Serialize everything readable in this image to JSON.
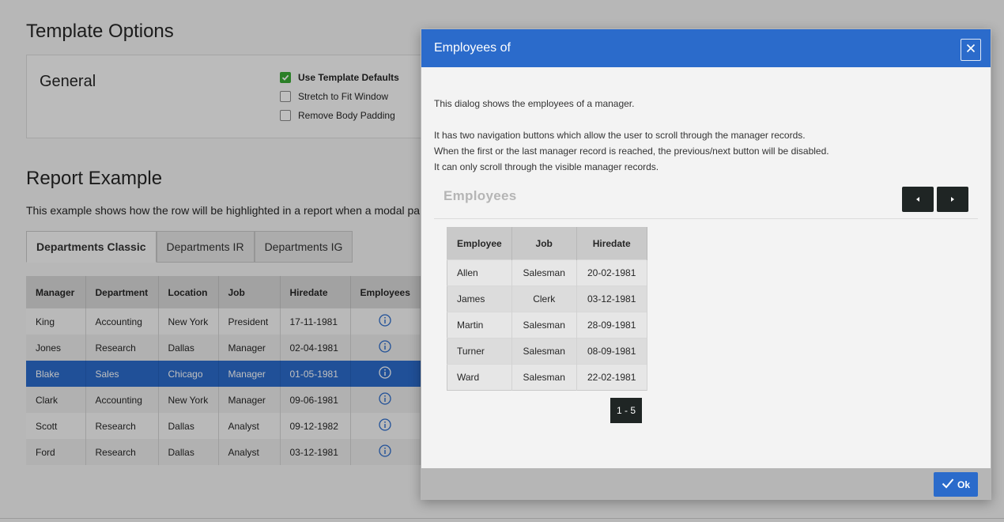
{
  "template_options": {
    "title": "Template Options",
    "general_title": "General",
    "options": [
      {
        "label": "Use Template Defaults",
        "checked": true
      },
      {
        "label": "Stretch to Fit Window",
        "checked": false
      },
      {
        "label": "Remove Body Padding",
        "checked": false
      }
    ]
  },
  "report_example": {
    "title": "Report Example",
    "description": "This example shows how the row will be highlighted in a report when a modal pa",
    "tabs": [
      "Departments Classic",
      "Departments IR",
      "Departments IG"
    ],
    "columns": [
      "Manager",
      "Department",
      "Location",
      "Job",
      "Hiredate",
      "Employees"
    ],
    "rows": [
      [
        "King",
        "Accounting",
        "New York",
        "President",
        "17-11-1981"
      ],
      [
        "Jones",
        "Research",
        "Dallas",
        "Manager",
        "02-04-1981"
      ],
      [
        "Blake",
        "Sales",
        "Chicago",
        "Manager",
        "01-05-1981"
      ],
      [
        "Clark",
        "Accounting",
        "New York",
        "Manager",
        "09-06-1981"
      ],
      [
        "Scott",
        "Research",
        "Dallas",
        "Analyst",
        "09-12-1982"
      ],
      [
        "Ford",
        "Research",
        "Dallas",
        "Analyst",
        "03-12-1981"
      ]
    ],
    "highlight_color": "#2b6bcb"
  },
  "dialog": {
    "title": "Employees of",
    "paragraphs": [
      "This dialog shows the employees of a manager.",
      "It has two navigation buttons which allow the user to scroll through the manager records.",
      "When the first or the last manager record is reached, the previous/next button will be disabled.",
      "It can only scroll through the visible manager records."
    ],
    "region_title": "Employees",
    "columns": [
      "Employee",
      "Job",
      "Hiredate"
    ],
    "rows": [
      [
        "Allen",
        "Salesman",
        "20-02-1981"
      ],
      [
        "James",
        "Clerk",
        "03-12-1981"
      ],
      [
        "Martin",
        "Salesman",
        "28-09-1981"
      ],
      [
        "Turner",
        "Salesman",
        "08-09-1981"
      ],
      [
        "Ward",
        "Salesman",
        "22-02-1981"
      ]
    ],
    "pagination": "1 - 5",
    "ok_label": "Ok",
    "header_color": "#2b6bcb"
  },
  "icons": {
    "close": "close-icon",
    "prev": "triangle-left-icon",
    "next": "triangle-right-icon",
    "check": "check-icon",
    "info": "info-circle-icon"
  }
}
